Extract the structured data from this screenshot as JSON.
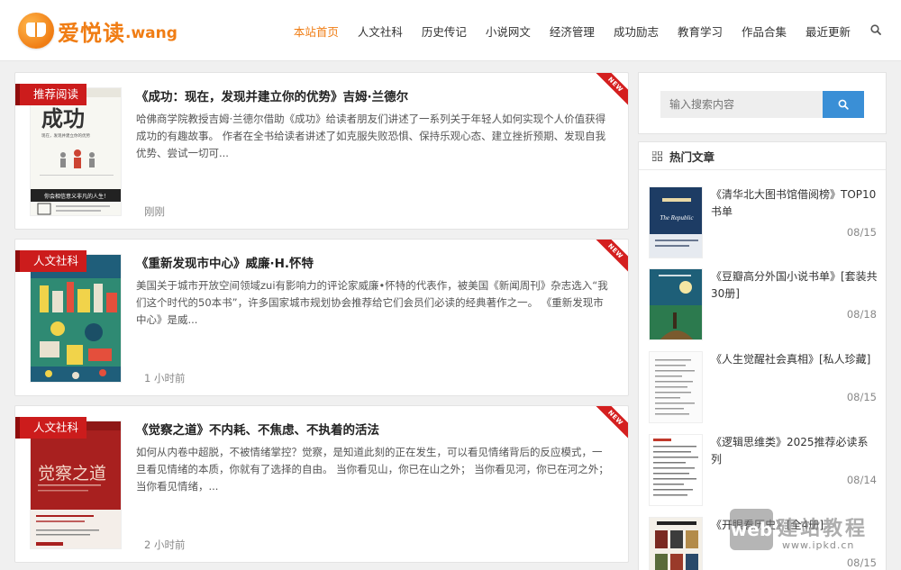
{
  "site": {
    "logo_text": "爱悦读",
    "logo_suffix": ".wang",
    "logo_badge": "爱悦"
  },
  "nav": {
    "items": [
      {
        "label": "本站首页",
        "active": true
      },
      {
        "label": "人文社科",
        "active": false
      },
      {
        "label": "历史传记",
        "active": false
      },
      {
        "label": "小说网文",
        "active": false
      },
      {
        "label": "经济管理",
        "active": false
      },
      {
        "label": "成功励志",
        "active": false
      },
      {
        "label": "教育学习",
        "active": false
      },
      {
        "label": "作品合集",
        "active": false
      },
      {
        "label": "最近更新",
        "active": false
      }
    ],
    "search_icon": "search-icon"
  },
  "posts": [
    {
      "tag": "推荐阅读",
      "title": "《成功：现在，发现并建立你的优势》吉姆·兰德尔",
      "excerpt": "哈佛商学院教授吉姆·兰德尔借助《成功》给读者朋友们讲述了一系列关于年轻人如何实现个人价值获得成功的有趣故事。 作者在全书给读者讲述了如克服失败恐惧、保持乐观心态、建立挫折预期、发现自我优势、尝试一切可...",
      "time": "刚刚",
      "ribbon": "NEW",
      "cover": {
        "big": "成功",
        "sub": "现在，发现并建立你的优势",
        "bottom": "你会相信意义非凡的人生！"
      }
    },
    {
      "tag": "人文社科",
      "title": "《重新发现市中心》威廉·H.怀特",
      "excerpt": "美国关于城市开放空间领域zui有影响力的评论家威廉•怀特的代表作，被美国《新闻周刊》杂志选入“我们这个时代的50本书”，许多国家城市规划协会推荐给它们会员们必读的经典著作之一。 《重新发现市中心》是威...",
      "time": "1 小时前",
      "ribbon": "NEW",
      "cover": {}
    },
    {
      "tag": "人文社科",
      "title": "《觉察之道》不内耗、不焦虑、不执着的活法",
      "excerpt": "如何从内卷中超脱，不被情绪掌控？觉察，是知道此刻的正在发生，可以看见情绪背后的反应模式，一旦看见情绪的本质，你就有了选择的自由。 当你看见山，你已在山之外； 当你看见河，你已在河之外； 当你看见情绪，...",
      "time": "2 小时前",
      "ribbon": "NEW",
      "cover": {
        "big": "觉察之道",
        "sub": "如何从内卷中超脱，不被情绪掌控？"
      }
    }
  ],
  "sidebar": {
    "search_placeholder": "输入搜索内容",
    "hot_title": "热门文章",
    "hot_items": [
      {
        "title": "《清华北大图书馆借阅榜》TOP10书单",
        "date": "08/15"
      },
      {
        "title": "《豆瓣高分外国小说书单》[套装共30册]",
        "date": "08/18"
      },
      {
        "title": "《人生觉醒社会真相》[私人珍藏]",
        "date": "08/15"
      },
      {
        "title": "《逻辑思维类》2025推荐必读系列",
        "date": "08/14"
      },
      {
        "title": "《开眼看历史》[全4册]",
        "date": "08/15"
      }
    ]
  },
  "watermark": {
    "box": "web",
    "main": "建站教程",
    "sub": "www.ipkd.cn"
  },
  "colors": {
    "accent": "#f07d14",
    "tag": "#cc1c1c",
    "button": "#3a8fd6",
    "ribbon": "#d41f1f"
  }
}
